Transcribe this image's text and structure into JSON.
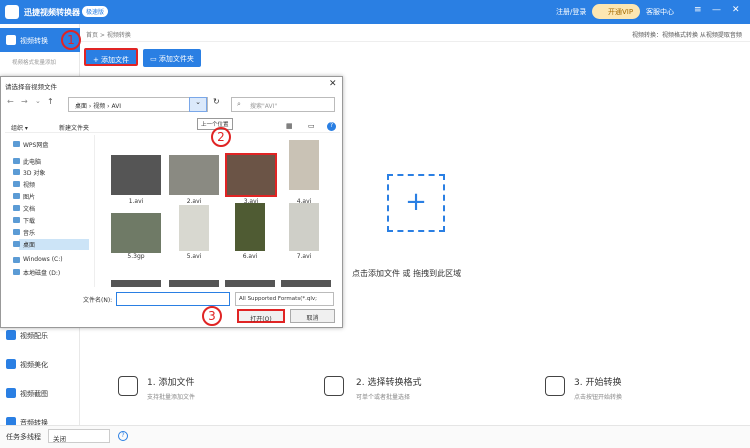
{
  "app": {
    "title": "迅捷视频转换器",
    "edition_badge": "极速版",
    "login": "注册/登录",
    "vip_button": "开通VIP",
    "service": "客服中心",
    "accent": "#2a7fe3",
    "annotation_color": "#e02424"
  },
  "sidebar": {
    "active": "视频转换",
    "active_sub": "视频格式批量添加",
    "items": [
      {
        "label": "视频配乐"
      },
      {
        "label": "视频美化"
      },
      {
        "label": "视频截图"
      },
      {
        "label": "音频转换"
      }
    ]
  },
  "main": {
    "breadcrumb": "首页 > 视频转换",
    "hint_right": "视频转换：视频格式转换 从视频提取音频",
    "add_file": "添加文件",
    "add_folder": "添加文件夹",
    "drop_text": "点击添加文件 或 拖拽到此区域",
    "steps": [
      {
        "title": "1. 添加文件",
        "sub": "支持批量添加文件"
      },
      {
        "title": "2. 选择转换格式",
        "sub": "可单个或者批量选择"
      },
      {
        "title": "3. 开始转换",
        "sub": "点击按钮开始转换"
      }
    ]
  },
  "status": {
    "task_label": "任务多线程",
    "task_value": "关闭"
  },
  "dialog": {
    "title": "请选择音视频文件",
    "path": [
      "桌面",
      "视频",
      "AVI"
    ],
    "search_placeholder": "搜索\"AVI\"",
    "tooltip": "上一个位置",
    "organize": "组织 ▾",
    "new_folder": "新建文件夹",
    "tree": [
      "WPS网盘",
      "此电脑",
      "3D 对象",
      "视频",
      "图片",
      "文档",
      "下载",
      "音乐",
      "桌面",
      "Windows (C:)",
      "本地磁盘 (D:)"
    ],
    "files": [
      "1.avi",
      "2.avi",
      "3.avi",
      "4.avi",
      "5.3gp",
      "5.avi",
      "6.avi",
      "7.avi"
    ],
    "filename_label": "文件名(N):",
    "filetype": "All Supported Formats(*.qlv;",
    "open": "打开(O)",
    "cancel": "取消"
  },
  "annotations": [
    "1",
    "2",
    "3"
  ]
}
